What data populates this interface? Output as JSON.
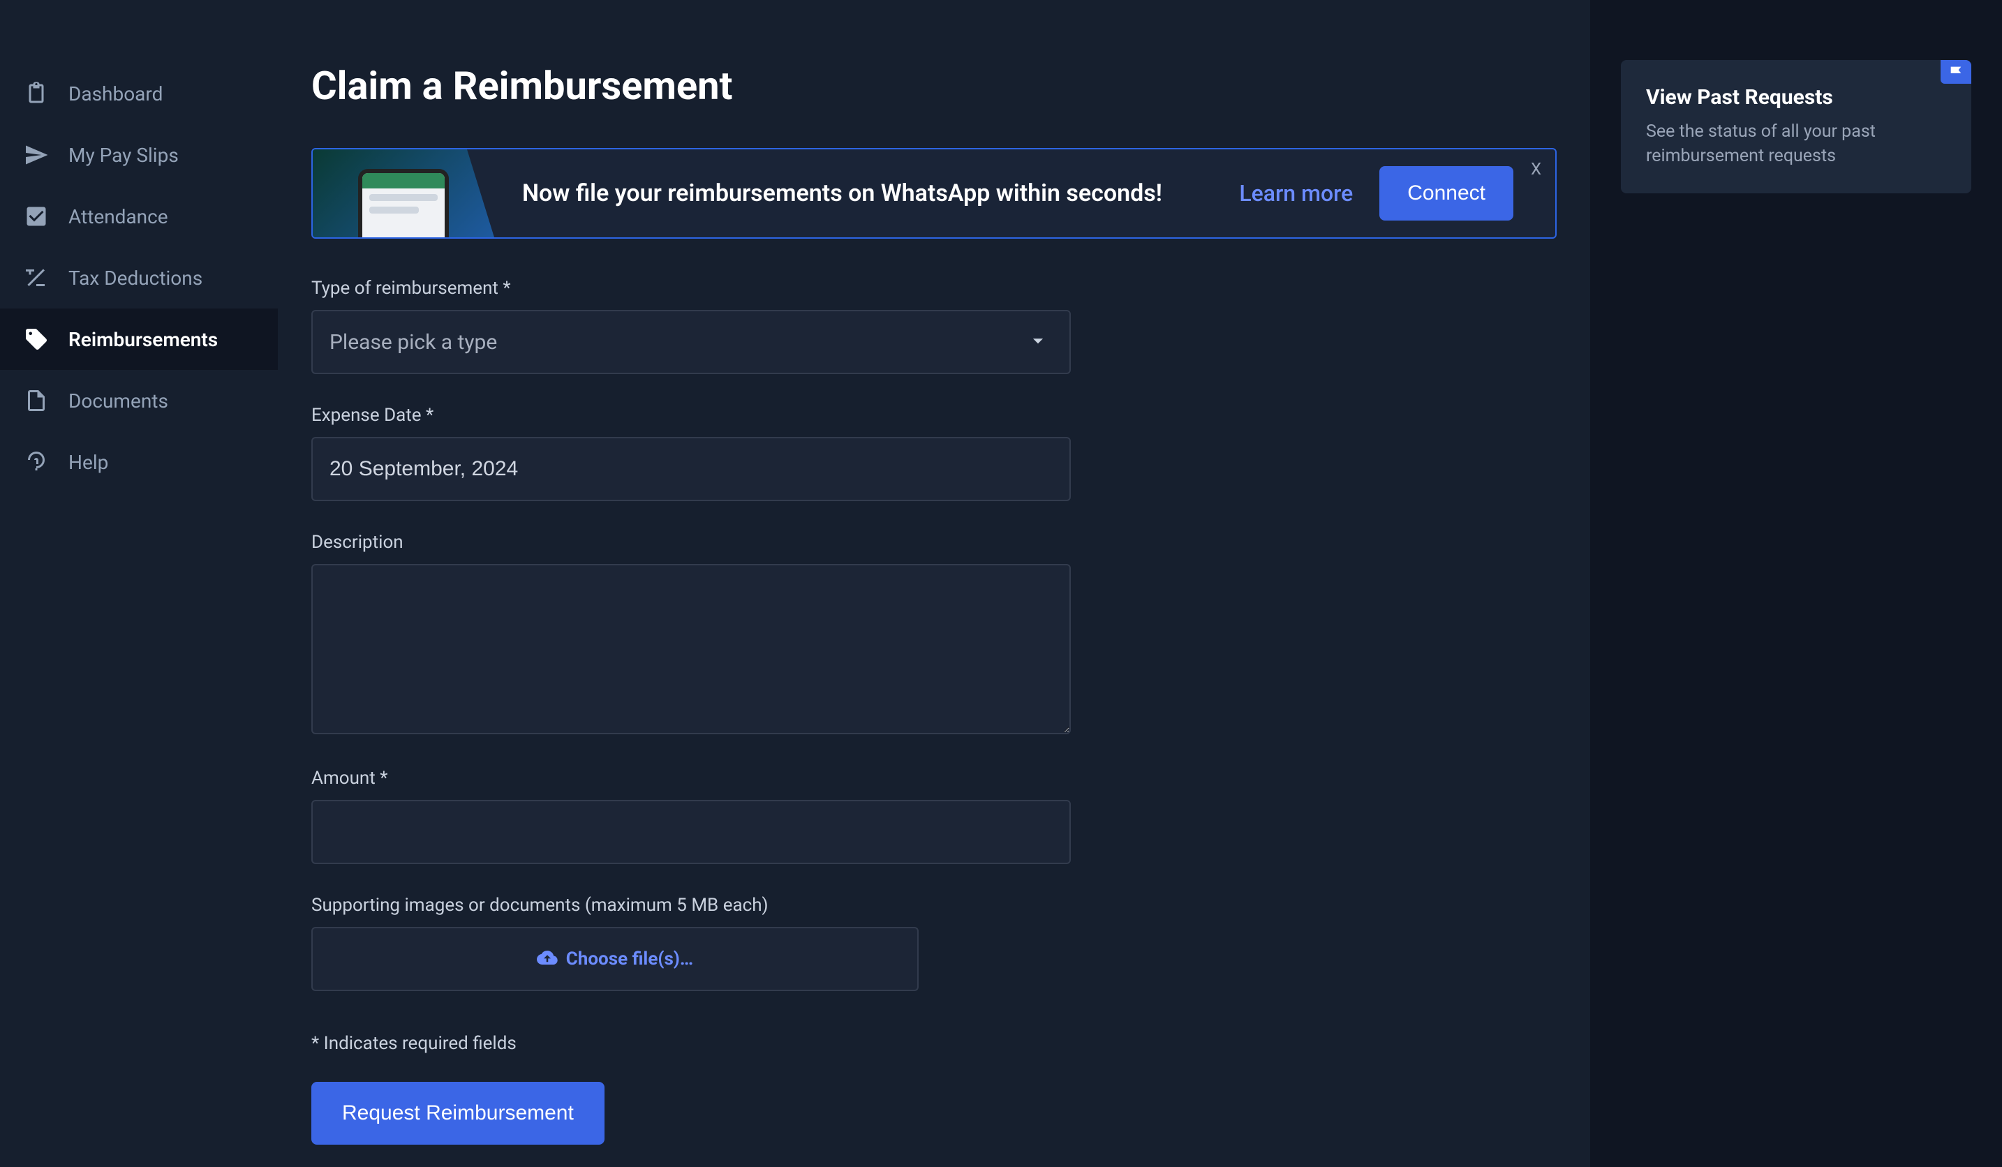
{
  "sidebar": {
    "items": [
      {
        "label": "Dashboard",
        "icon": "clipboard-icon",
        "active": false
      },
      {
        "label": "My Pay Slips",
        "icon": "send-icon",
        "active": false
      },
      {
        "label": "Attendance",
        "icon": "check-box-icon",
        "active": false
      },
      {
        "label": "Tax Deductions",
        "icon": "plus-minus-icon",
        "active": false
      },
      {
        "label": "Reimbursements",
        "icon": "tag-icon",
        "active": true
      },
      {
        "label": "Documents",
        "icon": "document-icon",
        "active": false
      },
      {
        "label": "Help",
        "icon": "help-icon",
        "active": false
      }
    ]
  },
  "page": {
    "title": "Claim a Reimbursement"
  },
  "banner": {
    "text": "Now file your reimbursements on WhatsApp within seconds!",
    "learn_more": "Learn more",
    "connect": "Connect",
    "close": "X"
  },
  "form": {
    "type_label": "Type of reimbursement *",
    "type_placeholder": "Please pick a type",
    "date_label": "Expense Date *",
    "date_value": "20 September, 2024",
    "description_label": "Description",
    "description_value": "",
    "amount_label": "Amount *",
    "amount_value": "",
    "file_label": "Supporting images or documents (maximum 5 MB each)",
    "file_button": "Choose file(s)…",
    "required_note": "* Indicates required fields",
    "submit": "Request Reimbursement"
  },
  "past_card": {
    "title": "View Past Requests",
    "subtitle": "See the status of all your past reimbursement requests"
  }
}
